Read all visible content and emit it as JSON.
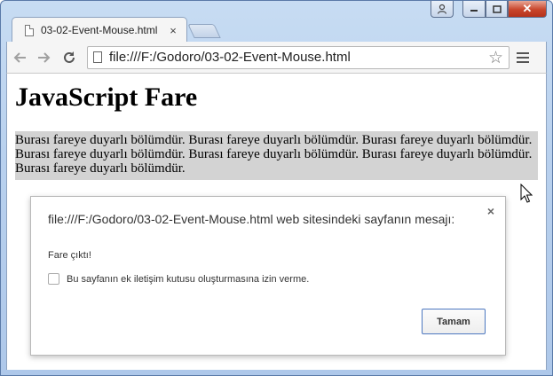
{
  "browser": {
    "tab": {
      "title": "03-02-Event-Mouse.html",
      "close_glyph": "×"
    },
    "window_controls": {
      "close_glyph": "✕"
    },
    "address_bar": {
      "url": "file:///F:/Godoro/03-02-Event-Mouse.html"
    },
    "icons": [
      "back-icon",
      "forward-icon",
      "reload-icon",
      "star-icon",
      "menu-icon",
      "page-icon"
    ]
  },
  "page": {
    "heading": "JavaScript Fare",
    "hover_text": "Burası fareye duyarlı bölümdür. Burası fareye duyarlı bölümdür. Burası fareye duyarlı bölümdür. Burası fareye duyarlı bölümdür. Burası fareye duyarlı bölümdür. Burası fareye duyarlı bölümdür. Burası fareye duyarlı bölümdür.",
    "hover_bg": "#d3d3d3"
  },
  "dialog": {
    "title": "file:///F:/Godoro/03-02-Event-Mouse.html web sitesindeki sayfanın mesajı:",
    "message": "Fare çıktı!",
    "checkbox_label": "Bu sayfanın ek iletişim kutusu oluşturmasına izin verme.",
    "ok_label": "Tamam",
    "close_glyph": "×"
  }
}
